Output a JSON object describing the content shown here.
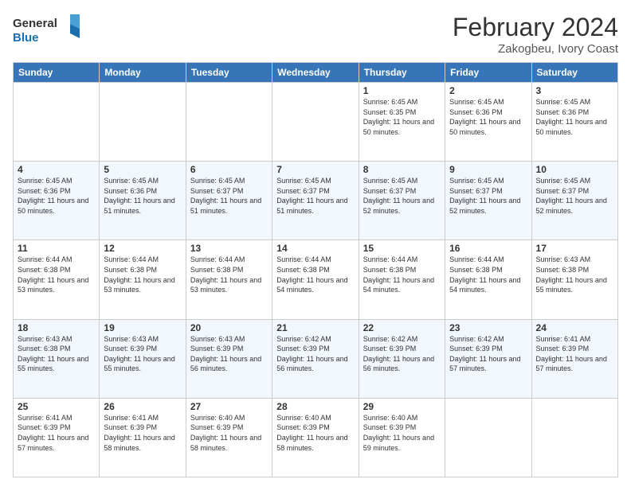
{
  "logo": {
    "line1": "General",
    "line2": "Blue"
  },
  "title": "February 2024",
  "subtitle": "Zakogbeu, Ivory Coast",
  "weekdays": [
    "Sunday",
    "Monday",
    "Tuesday",
    "Wednesday",
    "Thursday",
    "Friday",
    "Saturday"
  ],
  "weeks": [
    [
      {
        "day": "",
        "sunrise": "",
        "sunset": "",
        "daylight": ""
      },
      {
        "day": "",
        "sunrise": "",
        "sunset": "",
        "daylight": ""
      },
      {
        "day": "",
        "sunrise": "",
        "sunset": "",
        "daylight": ""
      },
      {
        "day": "",
        "sunrise": "",
        "sunset": "",
        "daylight": ""
      },
      {
        "day": "1",
        "sunrise": "6:45 AM",
        "sunset": "6:35 PM",
        "daylight": "11 hours and 50 minutes."
      },
      {
        "day": "2",
        "sunrise": "6:45 AM",
        "sunset": "6:36 PM",
        "daylight": "11 hours and 50 minutes."
      },
      {
        "day": "3",
        "sunrise": "6:45 AM",
        "sunset": "6:36 PM",
        "daylight": "11 hours and 50 minutes."
      }
    ],
    [
      {
        "day": "4",
        "sunrise": "6:45 AM",
        "sunset": "6:36 PM",
        "daylight": "11 hours and 50 minutes."
      },
      {
        "day": "5",
        "sunrise": "6:45 AM",
        "sunset": "6:36 PM",
        "daylight": "11 hours and 51 minutes."
      },
      {
        "day": "6",
        "sunrise": "6:45 AM",
        "sunset": "6:37 PM",
        "daylight": "11 hours and 51 minutes."
      },
      {
        "day": "7",
        "sunrise": "6:45 AM",
        "sunset": "6:37 PM",
        "daylight": "11 hours and 51 minutes."
      },
      {
        "day": "8",
        "sunrise": "6:45 AM",
        "sunset": "6:37 PM",
        "daylight": "11 hours and 52 minutes."
      },
      {
        "day": "9",
        "sunrise": "6:45 AM",
        "sunset": "6:37 PM",
        "daylight": "11 hours and 52 minutes."
      },
      {
        "day": "10",
        "sunrise": "6:45 AM",
        "sunset": "6:37 PM",
        "daylight": "11 hours and 52 minutes."
      }
    ],
    [
      {
        "day": "11",
        "sunrise": "6:44 AM",
        "sunset": "6:38 PM",
        "daylight": "11 hours and 53 minutes."
      },
      {
        "day": "12",
        "sunrise": "6:44 AM",
        "sunset": "6:38 PM",
        "daylight": "11 hours and 53 minutes."
      },
      {
        "day": "13",
        "sunrise": "6:44 AM",
        "sunset": "6:38 PM",
        "daylight": "11 hours and 53 minutes."
      },
      {
        "day": "14",
        "sunrise": "6:44 AM",
        "sunset": "6:38 PM",
        "daylight": "11 hours and 54 minutes."
      },
      {
        "day": "15",
        "sunrise": "6:44 AM",
        "sunset": "6:38 PM",
        "daylight": "11 hours and 54 minutes."
      },
      {
        "day": "16",
        "sunrise": "6:44 AM",
        "sunset": "6:38 PM",
        "daylight": "11 hours and 54 minutes."
      },
      {
        "day": "17",
        "sunrise": "6:43 AM",
        "sunset": "6:38 PM",
        "daylight": "11 hours and 55 minutes."
      }
    ],
    [
      {
        "day": "18",
        "sunrise": "6:43 AM",
        "sunset": "6:38 PM",
        "daylight": "11 hours and 55 minutes."
      },
      {
        "day": "19",
        "sunrise": "6:43 AM",
        "sunset": "6:39 PM",
        "daylight": "11 hours and 55 minutes."
      },
      {
        "day": "20",
        "sunrise": "6:43 AM",
        "sunset": "6:39 PM",
        "daylight": "11 hours and 56 minutes."
      },
      {
        "day": "21",
        "sunrise": "6:42 AM",
        "sunset": "6:39 PM",
        "daylight": "11 hours and 56 minutes."
      },
      {
        "day": "22",
        "sunrise": "6:42 AM",
        "sunset": "6:39 PM",
        "daylight": "11 hours and 56 minutes."
      },
      {
        "day": "23",
        "sunrise": "6:42 AM",
        "sunset": "6:39 PM",
        "daylight": "11 hours and 57 minutes."
      },
      {
        "day": "24",
        "sunrise": "6:41 AM",
        "sunset": "6:39 PM",
        "daylight": "11 hours and 57 minutes."
      }
    ],
    [
      {
        "day": "25",
        "sunrise": "6:41 AM",
        "sunset": "6:39 PM",
        "daylight": "11 hours and 57 minutes."
      },
      {
        "day": "26",
        "sunrise": "6:41 AM",
        "sunset": "6:39 PM",
        "daylight": "11 hours and 58 minutes."
      },
      {
        "day": "27",
        "sunrise": "6:40 AM",
        "sunset": "6:39 PM",
        "daylight": "11 hours and 58 minutes."
      },
      {
        "day": "28",
        "sunrise": "6:40 AM",
        "sunset": "6:39 PM",
        "daylight": "11 hours and 58 minutes."
      },
      {
        "day": "29",
        "sunrise": "6:40 AM",
        "sunset": "6:39 PM",
        "daylight": "11 hours and 59 minutes."
      },
      {
        "day": "",
        "sunrise": "",
        "sunset": "",
        "daylight": ""
      },
      {
        "day": "",
        "sunrise": "",
        "sunset": "",
        "daylight": ""
      }
    ]
  ]
}
